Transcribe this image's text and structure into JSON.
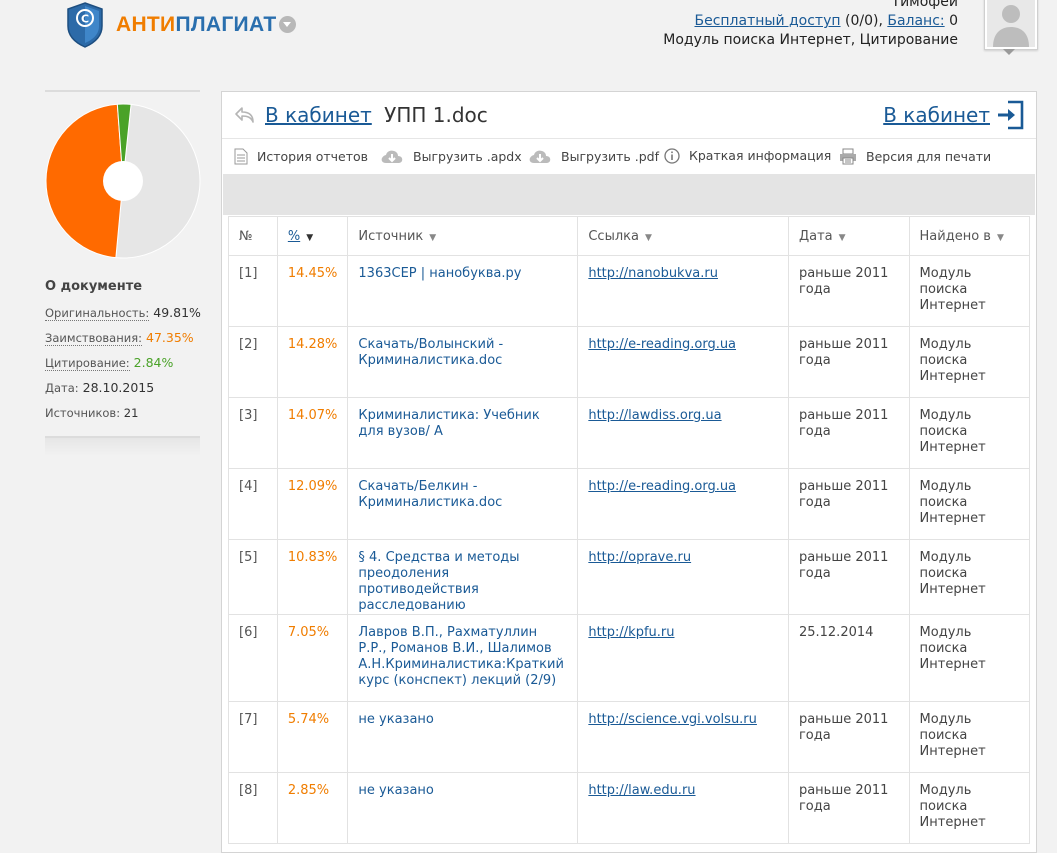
{
  "brand": {
    "part1": "АНТИ",
    "part2": "ПЛАГИАТ"
  },
  "user": {
    "name": "Тимофей",
    "free_access_label": "Бесплатный доступ",
    "free_access_count": "(0/0),",
    "balance_label": "Баланс:",
    "balance_value": "0",
    "modules": "Модуль поиска Интернет, Цитирование"
  },
  "sidebar": {
    "doc_section_title": "О документе",
    "originality_label": "Оригинальность:",
    "originality_value": "49.81%",
    "borrowing_label": "Заимствования:",
    "borrowing_value": "47.35%",
    "citation_label": "Цитирование:",
    "citation_value": "2.84%",
    "date_label": "Дата:",
    "date_value": "28.10.2015",
    "sources_label": "Источников:",
    "sources_value": "21",
    "pie": {
      "originality": 49.81,
      "borrowing": 47.35,
      "citation": 2.84
    },
    "colors": {
      "originality": "#e6e6e6",
      "borrowing": "#ff6a00",
      "citation": "#4aa228"
    }
  },
  "header": {
    "back_link": "В кабинет",
    "doc_name": "УПП 1.doc",
    "right_link": "В кабинет"
  },
  "toolbar": {
    "history": "История отчетов",
    "export_apdx": "Выгрузить .apdx",
    "export_pdf": "Выгрузить .pdf",
    "brief": "Краткая информация",
    "print": "Версия для печати"
  },
  "table": {
    "headers": {
      "num": "№",
      "pct": "%",
      "source": "Источник",
      "link": "Ссылка",
      "date": "Дата",
      "found": "Найдено в"
    },
    "rows": [
      {
        "num": "[1]",
        "pct": "14.45%",
        "source": "1363СЕР | нанобуква.ру",
        "link": "http://nanobukva.ru",
        "date": "раньше 2011 года",
        "found": "Модуль поиска Интернет"
      },
      {
        "num": "[2]",
        "pct": "14.28%",
        "source": "Скачать/Волынский - Криминалистика.doc",
        "link": "http://e-reading.org.ua",
        "date": "раньше 2011 года",
        "found": "Модуль поиска Интернет"
      },
      {
        "num": "[3]",
        "pct": "14.07%",
        "source": "Криминалистика: Учебник для вузов/ А",
        "link": "http://lawdiss.org.ua",
        "date": "раньше 2011 года",
        "found": "Модуль поиска Интернет"
      },
      {
        "num": "[4]",
        "pct": "12.09%",
        "source": "Скачать/Белкин - Криминалистика.doc",
        "link": "http://e-reading.org.ua",
        "date": "раньше 2011 года",
        "found": "Модуль поиска Интернет"
      },
      {
        "num": "[5]",
        "pct": "10.83%",
        "source": "§ 4. Средства и методы преодоления противодействия расследованию",
        "link": "http://oprave.ru",
        "date": "раньше 2011 года",
        "found": "Модуль поиска Интернет"
      },
      {
        "num": "[6]",
        "pct": "7.05%",
        "source": "Лавров В.П., Рахматуллин Р.Р., Романов В.И., Шалимов А.Н.Криминалистика:Краткий курс (конспект) лекций (2/9)",
        "link": "http://kpfu.ru",
        "date": "25.12.2014",
        "found": "Модуль поиска Интернет"
      },
      {
        "num": "[7]",
        "pct": "5.74%",
        "source": "не указано",
        "link": "http://science.vgi.volsu.ru",
        "date": "раньше 2011 года",
        "found": "Модуль поиска Интернет"
      },
      {
        "num": "[8]",
        "pct": "2.85%",
        "source": "не указано",
        "link": "http://law.edu.ru",
        "date": "раньше 2011 года",
        "found": "Модуль поиска Интернет"
      }
    ]
  }
}
